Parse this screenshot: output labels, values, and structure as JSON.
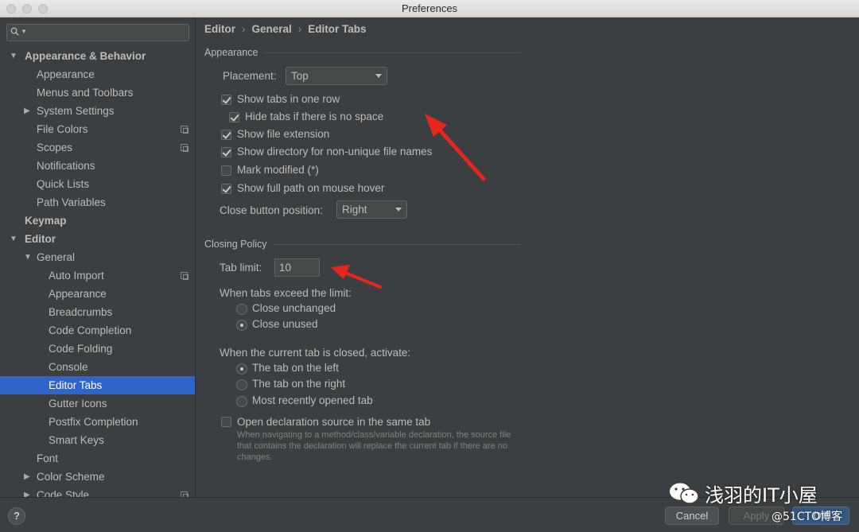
{
  "window": {
    "title": "Preferences"
  },
  "search": {
    "placeholder": ""
  },
  "sidebar": {
    "items": [
      {
        "label": "Appearance & Behavior",
        "level": 0,
        "arrow": "down",
        "bold": true
      },
      {
        "label": "Appearance",
        "level": 1
      },
      {
        "label": "Menus and Toolbars",
        "level": 1
      },
      {
        "label": "System Settings",
        "level": 1,
        "arrow": "right"
      },
      {
        "label": "File Colors",
        "level": 1,
        "project": true
      },
      {
        "label": "Scopes",
        "level": 1,
        "project": true
      },
      {
        "label": "Notifications",
        "level": 1
      },
      {
        "label": "Quick Lists",
        "level": 1
      },
      {
        "label": "Path Variables",
        "level": 1
      },
      {
        "label": "Keymap",
        "level": 0,
        "bold": true
      },
      {
        "label": "Editor",
        "level": 0,
        "arrow": "down",
        "bold": true
      },
      {
        "label": "General",
        "level": 1,
        "arrow": "down"
      },
      {
        "label": "Auto Import",
        "level": 2,
        "project": true
      },
      {
        "label": "Appearance",
        "level": 2
      },
      {
        "label": "Breadcrumbs",
        "level": 2
      },
      {
        "label": "Code Completion",
        "level": 2
      },
      {
        "label": "Code Folding",
        "level": 2
      },
      {
        "label": "Console",
        "level": 2
      },
      {
        "label": "Editor Tabs",
        "level": 2,
        "selected": true
      },
      {
        "label": "Gutter Icons",
        "level": 2
      },
      {
        "label": "Postfix Completion",
        "level": 2
      },
      {
        "label": "Smart Keys",
        "level": 2
      },
      {
        "label": "Font",
        "level": 1
      },
      {
        "label": "Color Scheme",
        "level": 1,
        "arrow": "right"
      },
      {
        "label": "Code Style",
        "level": 1,
        "arrow": "right",
        "project": true
      }
    ]
  },
  "breadcrumb": {
    "items": [
      "Editor",
      "General",
      "Editor Tabs"
    ],
    "separator": "›"
  },
  "appearance": {
    "section_title": "Appearance",
    "placement_label": "Placement:",
    "placement_value": "Top",
    "checkboxes": [
      {
        "label": "Show tabs in one row",
        "checked": true,
        "indent": false
      },
      {
        "label": "Hide tabs if there is no space",
        "checked": true,
        "indent": true
      },
      {
        "label": "Show file extension",
        "checked": true,
        "indent": false
      },
      {
        "label": "Show directory for non-unique file names",
        "checked": true,
        "indent": false
      },
      {
        "label": "Mark modified (*)",
        "checked": false,
        "indent": false
      },
      {
        "label": "Show full path on mouse hover",
        "checked": true,
        "indent": false
      }
    ],
    "close_button_label": "Close button position:",
    "close_button_value": "Right"
  },
  "closing": {
    "section_title": "Closing Policy",
    "tab_limit_label": "Tab limit:",
    "tab_limit_value": "10",
    "exceed_label": "When tabs exceed the limit:",
    "exceed_options": [
      {
        "label": "Close unchanged",
        "selected": false
      },
      {
        "label": "Close unused",
        "selected": true
      }
    ],
    "activate_label": "When the current tab is closed, activate:",
    "activate_options": [
      {
        "label": "The tab on the left",
        "selected": true
      },
      {
        "label": "The tab on the right",
        "selected": false
      },
      {
        "label": "Most recently opened tab",
        "selected": false
      }
    ],
    "declaration_label": "Open declaration source in the same tab",
    "declaration_checked": false,
    "declaration_hint": "When navigating to a method/class/variable declaration, the source file that contains the declaration will replace the current tab if there are no changes."
  },
  "buttons": {
    "help": "?",
    "cancel": "Cancel",
    "apply": "Apply",
    "ok": "OK"
  },
  "watermark": {
    "line1": "浅羽的IT小屋",
    "line2": "@51CTO博客"
  },
  "colors": {
    "selection": "#2f65ca",
    "background": "#3c3f41",
    "arrow": "#e8251f",
    "ok_button": "#365880"
  }
}
